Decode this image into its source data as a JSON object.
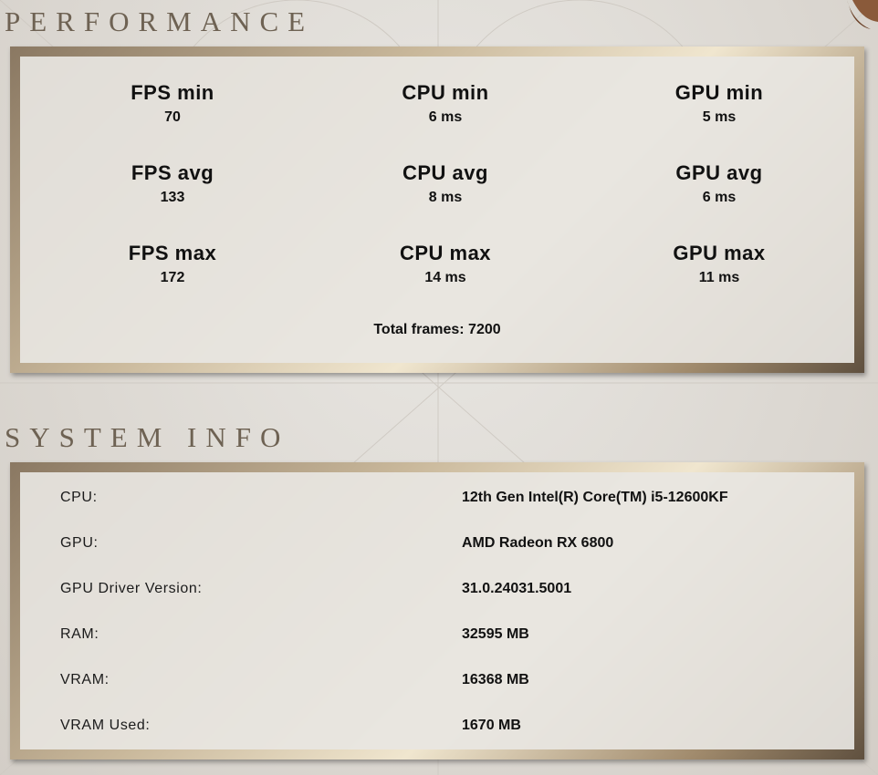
{
  "performance": {
    "title": "PERFORMANCE",
    "stats": [
      {
        "label": "FPS min",
        "value": "70"
      },
      {
        "label": "CPU min",
        "value": "6 ms"
      },
      {
        "label": "GPU min",
        "value": "5 ms"
      },
      {
        "label": "FPS avg",
        "value": "133"
      },
      {
        "label": "CPU avg",
        "value": "8 ms"
      },
      {
        "label": "GPU avg",
        "value": "6 ms"
      },
      {
        "label": "FPS max",
        "value": "172"
      },
      {
        "label": "CPU max",
        "value": "14 ms"
      },
      {
        "label": "GPU max",
        "value": "11 ms"
      }
    ],
    "total_frames": "Total frames: 7200"
  },
  "system_info": {
    "title": "SYSTEM INFO",
    "rows": [
      {
        "label": "CPU:",
        "value": "12th Gen Intel(R) Core(TM) i5-12600KF"
      },
      {
        "label": "GPU:",
        "value": "AMD Radeon RX 6800"
      },
      {
        "label": "GPU Driver Version:",
        "value": "31.0.24031.5001"
      },
      {
        "label": "RAM:",
        "value": "32595 MB"
      },
      {
        "label": "VRAM:",
        "value": "16368 MB"
      },
      {
        "label": "VRAM Used:",
        "value": "1670 MB"
      }
    ]
  },
  "colors": {
    "background": "#ddd9d3",
    "title": "#6e6253",
    "frame_gold": "#c9b89b",
    "panel": "#e8e6e2"
  }
}
